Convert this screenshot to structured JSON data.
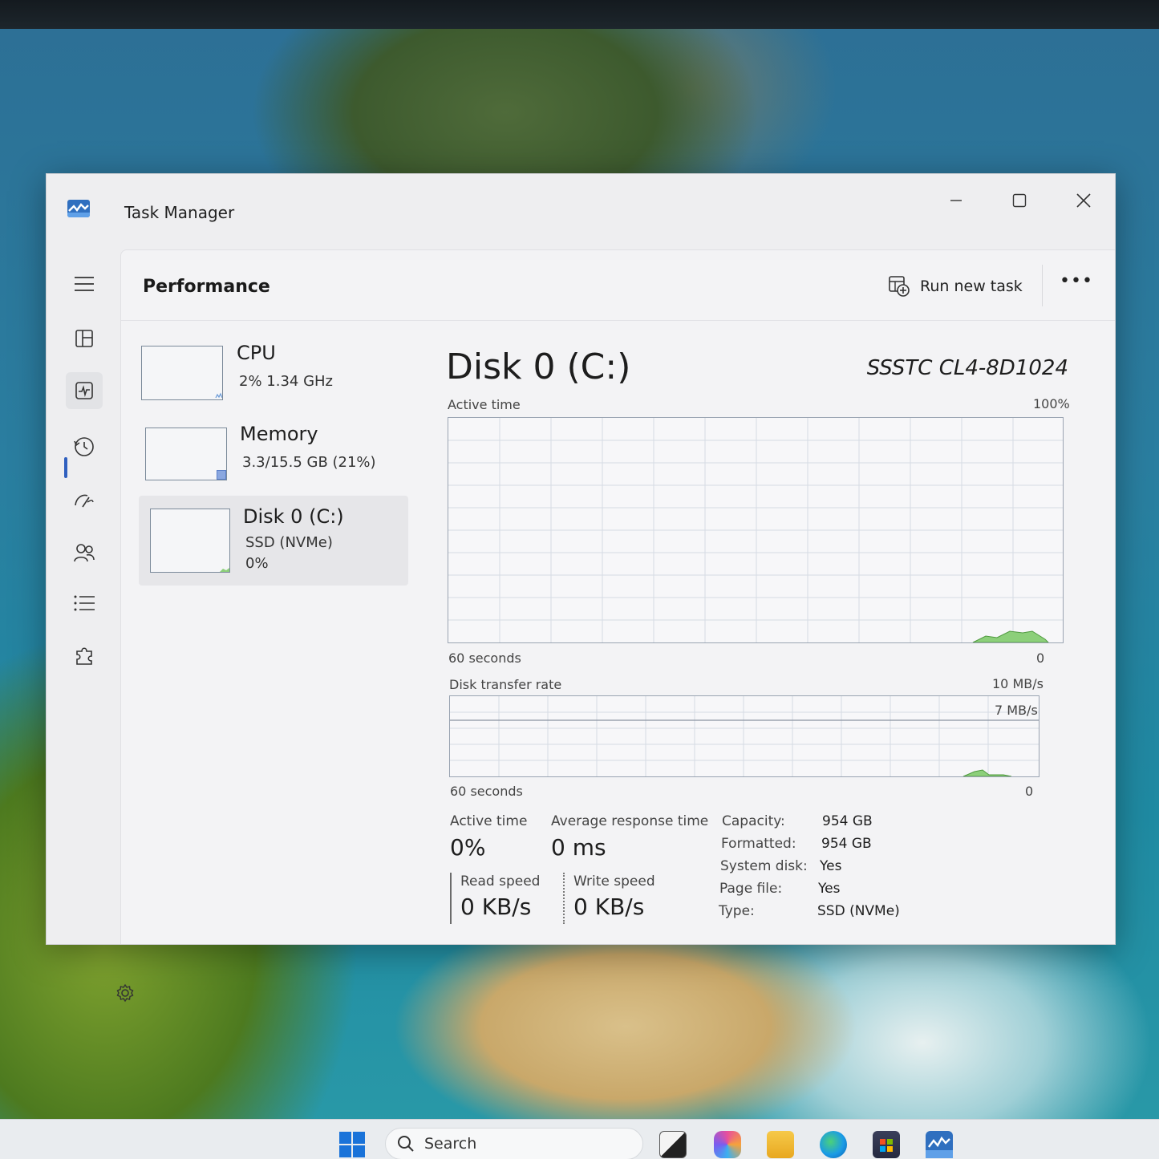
{
  "window": {
    "title": "Task Manager"
  },
  "header": {
    "page_title": "Performance",
    "run_new_task": "Run new task",
    "more": "•••"
  },
  "devices": [
    {
      "name": "CPU",
      "sub1": "2%  1.34 GHz",
      "sub2": ""
    },
    {
      "name": "Memory",
      "sub1": "3.3/15.5 GB (21%)",
      "sub2": ""
    },
    {
      "name": "Disk 0 (C:)",
      "sub1": "SSD (NVMe)",
      "sub2": "0%"
    }
  ],
  "detail": {
    "title": "Disk 0 (C:)",
    "model": "SSSTC CL4-8D1024",
    "active_chart": {
      "label": "Active time",
      "max": "100%",
      "x_left": "60 seconds",
      "x_right": "0"
    },
    "transfer_chart": {
      "label": "Disk transfer rate",
      "max": "10 MB/s",
      "line_label": "7 MB/s",
      "x_left": "60 seconds",
      "x_right": "0"
    },
    "stats": {
      "active_time_label": "Active time",
      "active_time_value": "0%",
      "avg_response_label": "Average response time",
      "avg_response_value": "0 ms",
      "read_speed_label": "Read speed",
      "read_speed_value": "0 KB/s",
      "write_speed_label": "Write speed",
      "write_speed_value": "0 KB/s"
    },
    "properties": [
      {
        "label": "Capacity:",
        "value": "954 GB"
      },
      {
        "label": "Formatted:",
        "value": "954 GB"
      },
      {
        "label": "System disk:",
        "value": "Yes"
      },
      {
        "label": "Page file:",
        "value": "Yes"
      },
      {
        "label": "Type:",
        "value": "SSD (NVMe)"
      }
    ]
  },
  "taskbar": {
    "search_label": "Search"
  },
  "colors": {
    "accent": "#2f5fbf",
    "disk_graph_fill": "#8ccf7a",
    "disk_graph_line": "#4f9a3f"
  }
}
